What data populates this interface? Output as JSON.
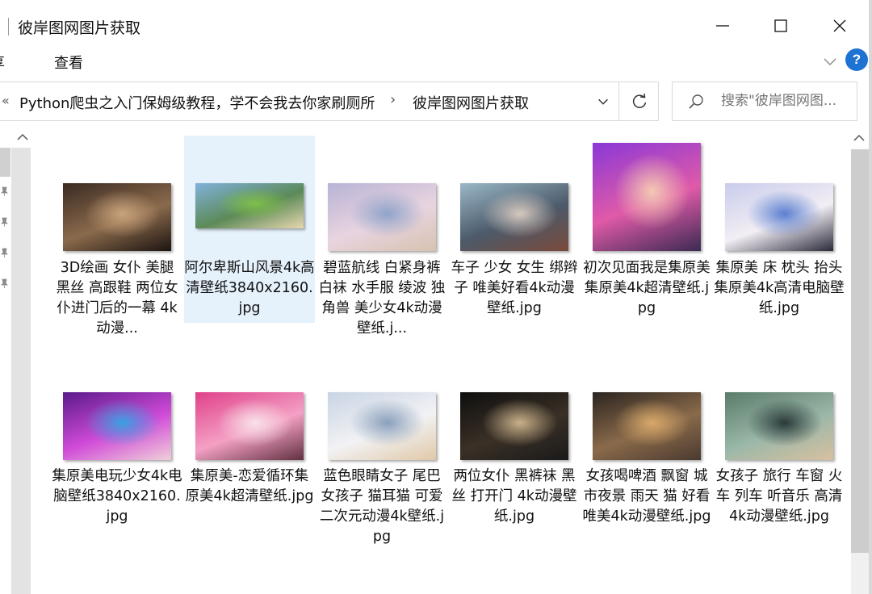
{
  "window": {
    "title": "彼岸图网图片获取",
    "icons": {
      "minimize": "minimize-icon",
      "maximize": "maximize-icon",
      "close": "close-icon"
    }
  },
  "ribbon": {
    "tabs": [
      "享",
      "查看"
    ],
    "help_label": "?"
  },
  "address": {
    "prev_glyph": "«",
    "crumbs": [
      "Python爬虫之入门保姆级教程，学不会我去你家刷厕所",
      "彼岸图网图片获取"
    ],
    "separator": "›"
  },
  "search": {
    "placeholder": "搜索\"彼岸图网图..."
  },
  "files": [
    {
      "name": "3D绘画 女仆 美腿 黑丝 高跟鞋 两位女仆进门后的一幕 4k动漫...",
      "selected": false,
      "colors": [
        "#3a2a22",
        "#8a6a4c",
        "#c9a27b",
        "#1c1410"
      ]
    },
    {
      "name": "阿尔卑斯山风景4k高清壁纸3840x2160.jpg",
      "selected": true,
      "colors": [
        "#7fb2dc",
        "#5c8a58",
        "#7fbf4a",
        "#e8d7b0"
      ]
    },
    {
      "name": "碧蓝航线 白紧身裤 白袜 水手服 绫波 独角兽 美少女4k动漫壁纸.j...",
      "selected": false,
      "colors": [
        "#b8b3d6",
        "#e8d4df",
        "#8fa3c9",
        "#d7c2b0"
      ]
    },
    {
      "name": "车子 少女 女生 绑辫子 唯美好看4k动漫壁纸.jpg",
      "selected": false,
      "colors": [
        "#9ab8c8",
        "#4c5a6a",
        "#d7c9bf",
        "#7a4a3a"
      ]
    },
    {
      "name": "初次见面我是集原美 集原美4k超清壁纸.jpg",
      "selected": false,
      "colors": [
        "#8a38d8",
        "#e05aa8",
        "#f4c9b4",
        "#3b2a52"
      ]
    },
    {
      "name": "集原美 床 枕头 抬头 集原美4k高清电脑壁纸.jpg",
      "selected": false,
      "colors": [
        "#c9ccec",
        "#f2eef4",
        "#5b7fd0",
        "#2a2a3a"
      ]
    },
    {
      "name": "集原美电玩少女4k电脑壁纸3840x2160.jpg",
      "selected": false,
      "colors": [
        "#5a1a8a",
        "#d04ad8",
        "#3aa0e0",
        "#f0d0d8"
      ]
    },
    {
      "name": "集原美-恋爱循环集原美4k超清壁纸.jpg",
      "selected": false,
      "colors": [
        "#e0408a",
        "#f4a0c4",
        "#f8e0e8",
        "#603040"
      ]
    },
    {
      "name": "蓝色眼睛女子 尾巴 女孩子 猫耳猫 可爱二次元动漫4k壁纸.jpg",
      "selected": false,
      "colors": [
        "#c8d4e4",
        "#f2f2f4",
        "#8aa0bc",
        "#e0c8a8"
      ]
    },
    {
      "name": "两位女仆 黑裤袜 黑丝 打开门 4k动漫壁纸.jpg",
      "selected": false,
      "colors": [
        "#0e0e0e",
        "#3a3026",
        "#c8b08a",
        "#1a1a1a"
      ]
    },
    {
      "name": "女孩喝啤酒 飘窗 城市夜景 雨天 猫 好看唯美4k动漫壁纸.jpg",
      "selected": false,
      "colors": [
        "#2a2420",
        "#8a6a4a",
        "#d8a86a",
        "#4a3a30"
      ]
    },
    {
      "name": "女孩子 旅行 车窗 火车 列车 听音乐 高清4k动漫壁纸.jpg",
      "selected": false,
      "colors": [
        "#5a7a6a",
        "#9ab8a8",
        "#2a3a3a",
        "#d8c0a0"
      ]
    }
  ]
}
